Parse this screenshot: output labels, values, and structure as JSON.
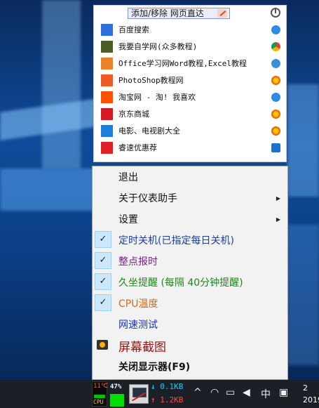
{
  "links_panel": {
    "add_remove_label": "添加/移除 网页直达",
    "links": [
      {
        "label": "百度搜索",
        "icon": "baidu-paw",
        "icon_color": "#2e6fd9",
        "browser": "ie"
      },
      {
        "label": "我要自学网(众多教程)",
        "icon": "checkmark-v",
        "icon_color": "#4b5e23",
        "browser": "chrome"
      },
      {
        "label": "Office学习网Word教程,Excel教程",
        "icon": "office-squares",
        "icon_color": "#e8832a",
        "browser": "chromium"
      },
      {
        "label": "PhotoShop教程网",
        "icon": "ps",
        "icon_color": "#f05a28",
        "browser": "firefox"
      },
      {
        "label": "淘宝网 - 淘! 我喜欢",
        "icon": "taobao",
        "icon_color": "#ff5000",
        "browser": "ie"
      },
      {
        "label": "京东商城",
        "icon": "jd",
        "icon_color": "#d71920",
        "browser": "firefox"
      },
      {
        "label": "电影、电视剧大全",
        "icon": "ie-e",
        "icon_color": "#1e7fd9",
        "browser": "firefox"
      },
      {
        "label": "睿速优惠荐",
        "icon": "you",
        "icon_color": "#e02020",
        "browser": "edge"
      }
    ]
  },
  "menu": {
    "items": [
      {
        "label": "退出",
        "checked": false,
        "submenu": false,
        "color": "#111111"
      },
      {
        "label": "关于仪表助手",
        "checked": false,
        "submenu": true,
        "color": "#111111"
      },
      {
        "label": "设置",
        "checked": false,
        "submenu": true,
        "color": "#111111"
      },
      {
        "label": "定时关机(已指定每日关机)",
        "checked": true,
        "submenu": false,
        "color": "#1a3f9c"
      },
      {
        "label": "整点报时",
        "checked": true,
        "submenu": false,
        "color": "#7a1f8a"
      },
      {
        "label": "久坐提醒 (每隔 40分钟提醒)",
        "checked": true,
        "submenu": false,
        "color": "#1a8a1a"
      },
      {
        "label": "CPU温度",
        "checked": true,
        "submenu": false,
        "color": "#d2691e"
      },
      {
        "label": "网速测试",
        "checked": false,
        "submenu": false,
        "color": "#1a2fc4"
      },
      {
        "label": "屏幕截图",
        "checked": false,
        "submenu": false,
        "color": "#a01010"
      },
      {
        "label": "关闭显示器(F9)",
        "checked": false,
        "submenu": false,
        "color": "#111111"
      }
    ],
    "check_glyph": "✓",
    "submenu_glyph": "▶"
  },
  "taskbar": {
    "cpu_temp": "11℃",
    "cpu_label": "CPU",
    "mem_percent": "47%",
    "net_down": "0.1KB",
    "net_up": "1.2KB",
    "tray_up_arrow": "^",
    "ime": "中",
    "clock_time": "2",
    "clock_date": "2019"
  }
}
